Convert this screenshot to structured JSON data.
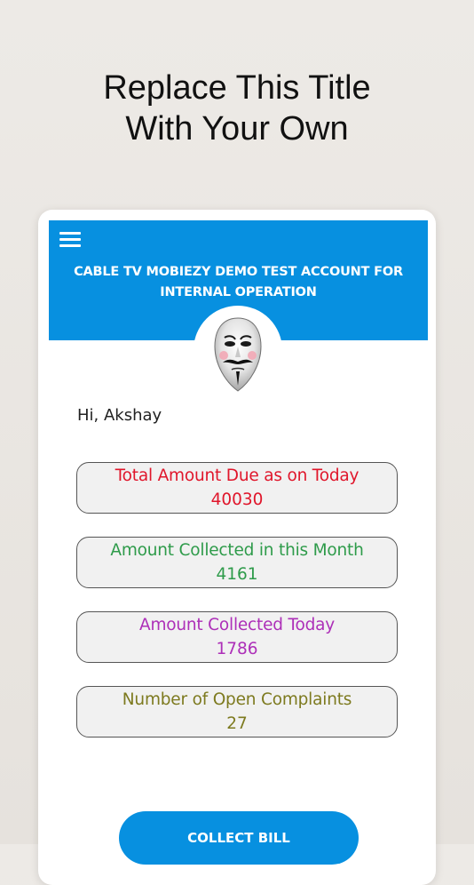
{
  "promo": {
    "title_line1": "Replace This Title",
    "title_line2": "With Your Own"
  },
  "header": {
    "menu_icon": "hamburger-menu-icon",
    "company_name": "CABLE TV MOBIEZY DEMO TEST ACCOUNT FOR INTERNAL OPERATION",
    "background_color": "#0790e0"
  },
  "avatar": {
    "icon": "mask-avatar-icon"
  },
  "greeting": "Hi, Akshay",
  "stats": [
    {
      "label": "Total Amount Due as on Today",
      "value": "40030",
      "color": "#e0162b"
    },
    {
      "label": "Amount Collected in this Month",
      "value": "4161",
      "color": "#2e9b4a"
    },
    {
      "label": "Amount Collected Today",
      "value": "1786",
      "color": "#ad2fb8"
    },
    {
      "label": "Number of Open Complaints",
      "value": "27",
      "color": "#7d7a1f"
    }
  ],
  "actions": {
    "collect_bill_label": "COLLECT BILL"
  }
}
